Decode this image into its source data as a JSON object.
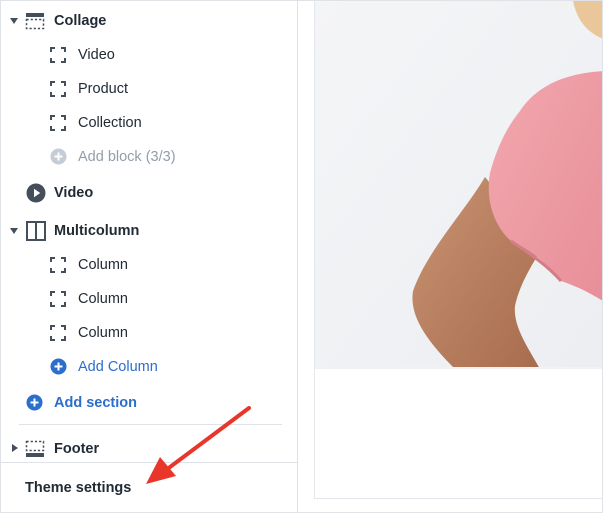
{
  "sidebar": {
    "collage": {
      "label": "Collage",
      "blocks": [
        {
          "label": "Video"
        },
        {
          "label": "Product"
        },
        {
          "label": "Collection"
        }
      ],
      "add_block": "Add block (3/3)"
    },
    "video": {
      "label": "Video"
    },
    "multicolumn": {
      "label": "Multicolumn",
      "blocks": [
        {
          "label": "Column"
        },
        {
          "label": "Column"
        },
        {
          "label": "Column"
        }
      ],
      "add_block": "Add Column"
    },
    "add_section": "Add section",
    "footer": {
      "label": "Footer"
    },
    "theme_settings": "Theme settings"
  },
  "colors": {
    "accent_blue": "#2c6ecb",
    "muted_gray": "#919eab",
    "annotation_red": "#e8362b",
    "shirt_pink": "#ee9aa3",
    "skin": "#c48a66"
  },
  "icons": {
    "section_collage": "section-header-icon",
    "block": "dashed-square-icon",
    "add": "plus-circle-icon",
    "video": "play-circle-icon",
    "multicolumn": "columns-icon",
    "footer": "section-footer-icon"
  }
}
